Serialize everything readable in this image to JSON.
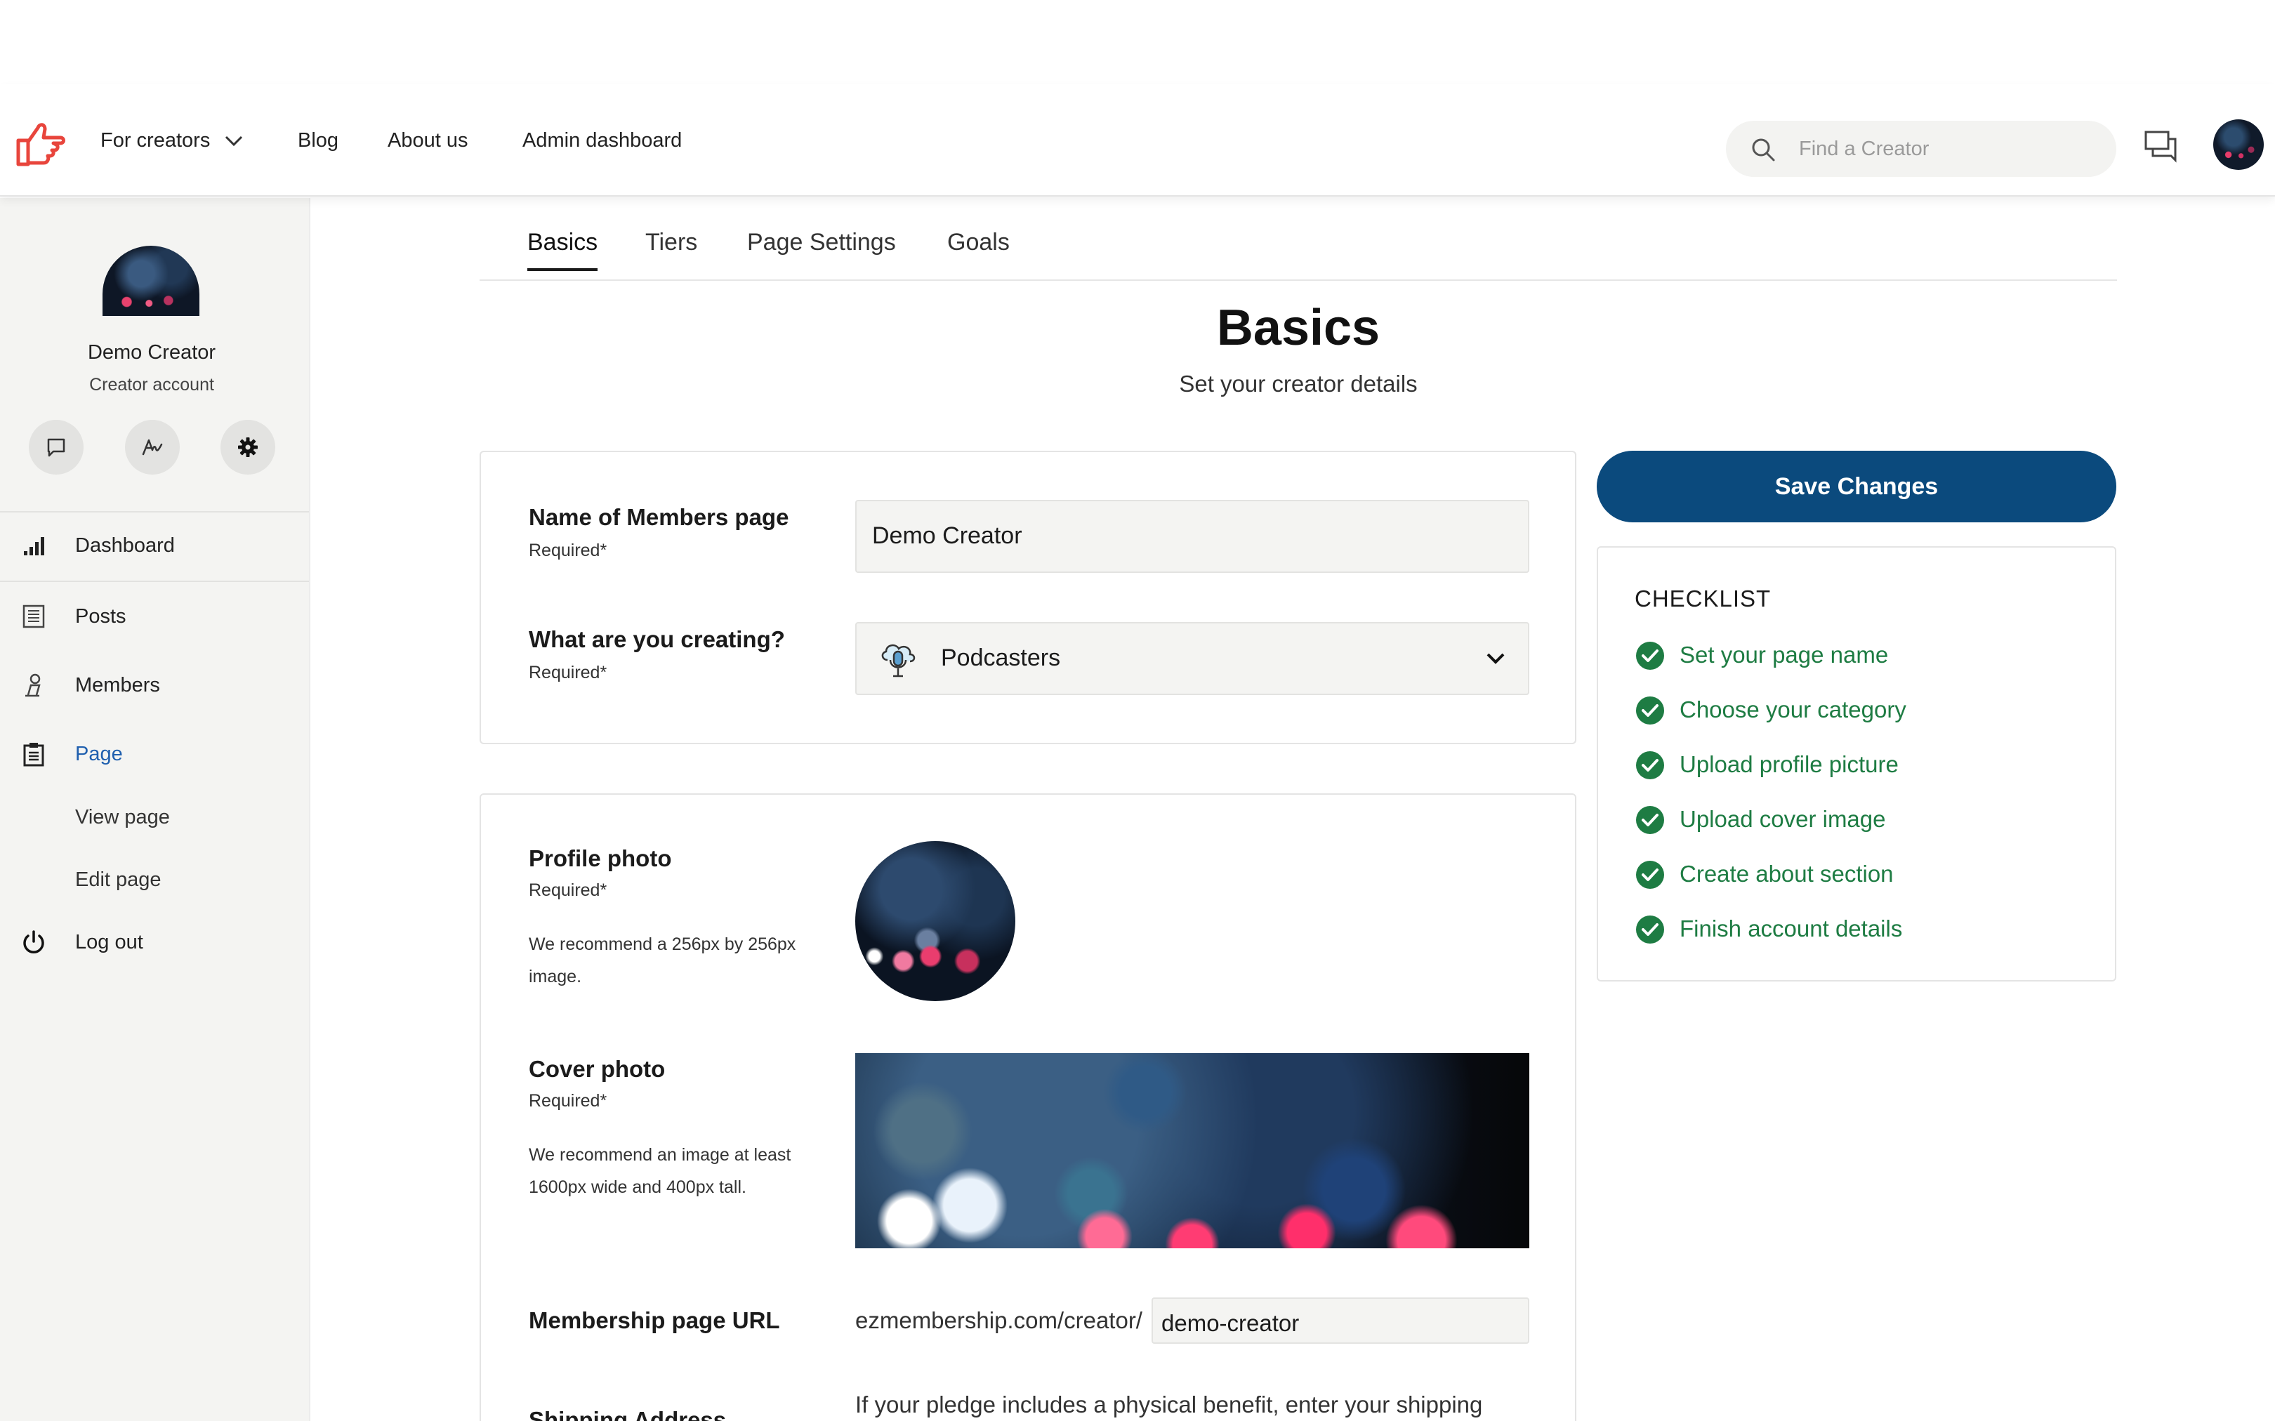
{
  "nav": {
    "for_creators": "For creators",
    "blog": "Blog",
    "about": "About us",
    "admin": "Admin dashboard",
    "search_placeholder": "Find a Creator"
  },
  "sidebar": {
    "user_name": "Demo Creator",
    "user_role": "Creator account",
    "items": {
      "dashboard": "Dashboard",
      "posts": "Posts",
      "members": "Members",
      "page": "Page",
      "view_page": "View page",
      "edit_page": "Edit page",
      "logout": "Log out"
    }
  },
  "tabs": [
    "Basics",
    "Tiers",
    "Page Settings",
    "Goals"
  ],
  "header": {
    "title": "Basics",
    "subtitle": "Set your creator details"
  },
  "form": {
    "page_name": {
      "label": "Name of Members page",
      "required": "Required*",
      "value": "Demo Creator"
    },
    "category": {
      "label": "What are you creating?",
      "required": "Required*",
      "value": "Podcasters"
    },
    "profile_photo": {
      "label": "Profile photo",
      "required": "Required*",
      "help": "We recommend a 256px by 256px image."
    },
    "cover_photo": {
      "label": "Cover photo",
      "required": "Required*",
      "help": "We recommend an image at least 1600px wide and 400px tall."
    },
    "url": {
      "label": "Membership page URL",
      "prefix": "ezmembership.com/creator/",
      "value": "demo-creator"
    },
    "shipping": {
      "label": "Shipping Address",
      "text": "If your pledge includes a physical benefit, enter your shipping"
    }
  },
  "actions": {
    "save": "Save Changes"
  },
  "checklist": {
    "title": "CHECKLIST",
    "items": [
      "Set your page name",
      "Choose your category",
      "Upload profile picture",
      "Upload cover image",
      "Create about section",
      "Finish account details"
    ]
  },
  "colors": {
    "primary": "#0b4a7d",
    "check_green": "#1e7c43",
    "active_link": "#1f5fae",
    "logo_red": "#e8453c"
  }
}
